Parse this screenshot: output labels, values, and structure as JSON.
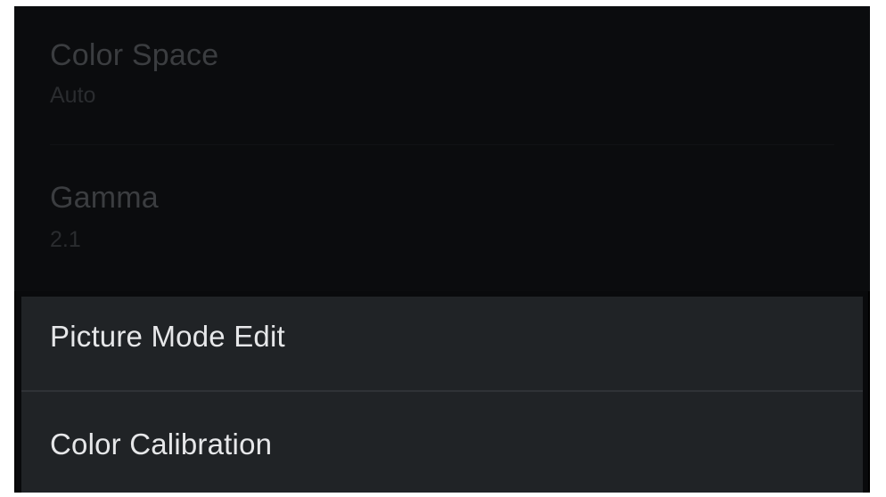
{
  "settings_list": {
    "items": [
      {
        "label": "Color Space",
        "value": "Auto"
      },
      {
        "label": "Gamma",
        "value": "2.1"
      }
    ]
  },
  "submenu": {
    "picture_mode_edit_label": "Picture Mode Edit",
    "color_calibration_label": "Color Calibration"
  },
  "colors": {
    "background": "#090a0c",
    "menu_item_background": "#202326",
    "menu_item_text": "#e6e7e9",
    "dimmed_text": "#3b3d40"
  }
}
